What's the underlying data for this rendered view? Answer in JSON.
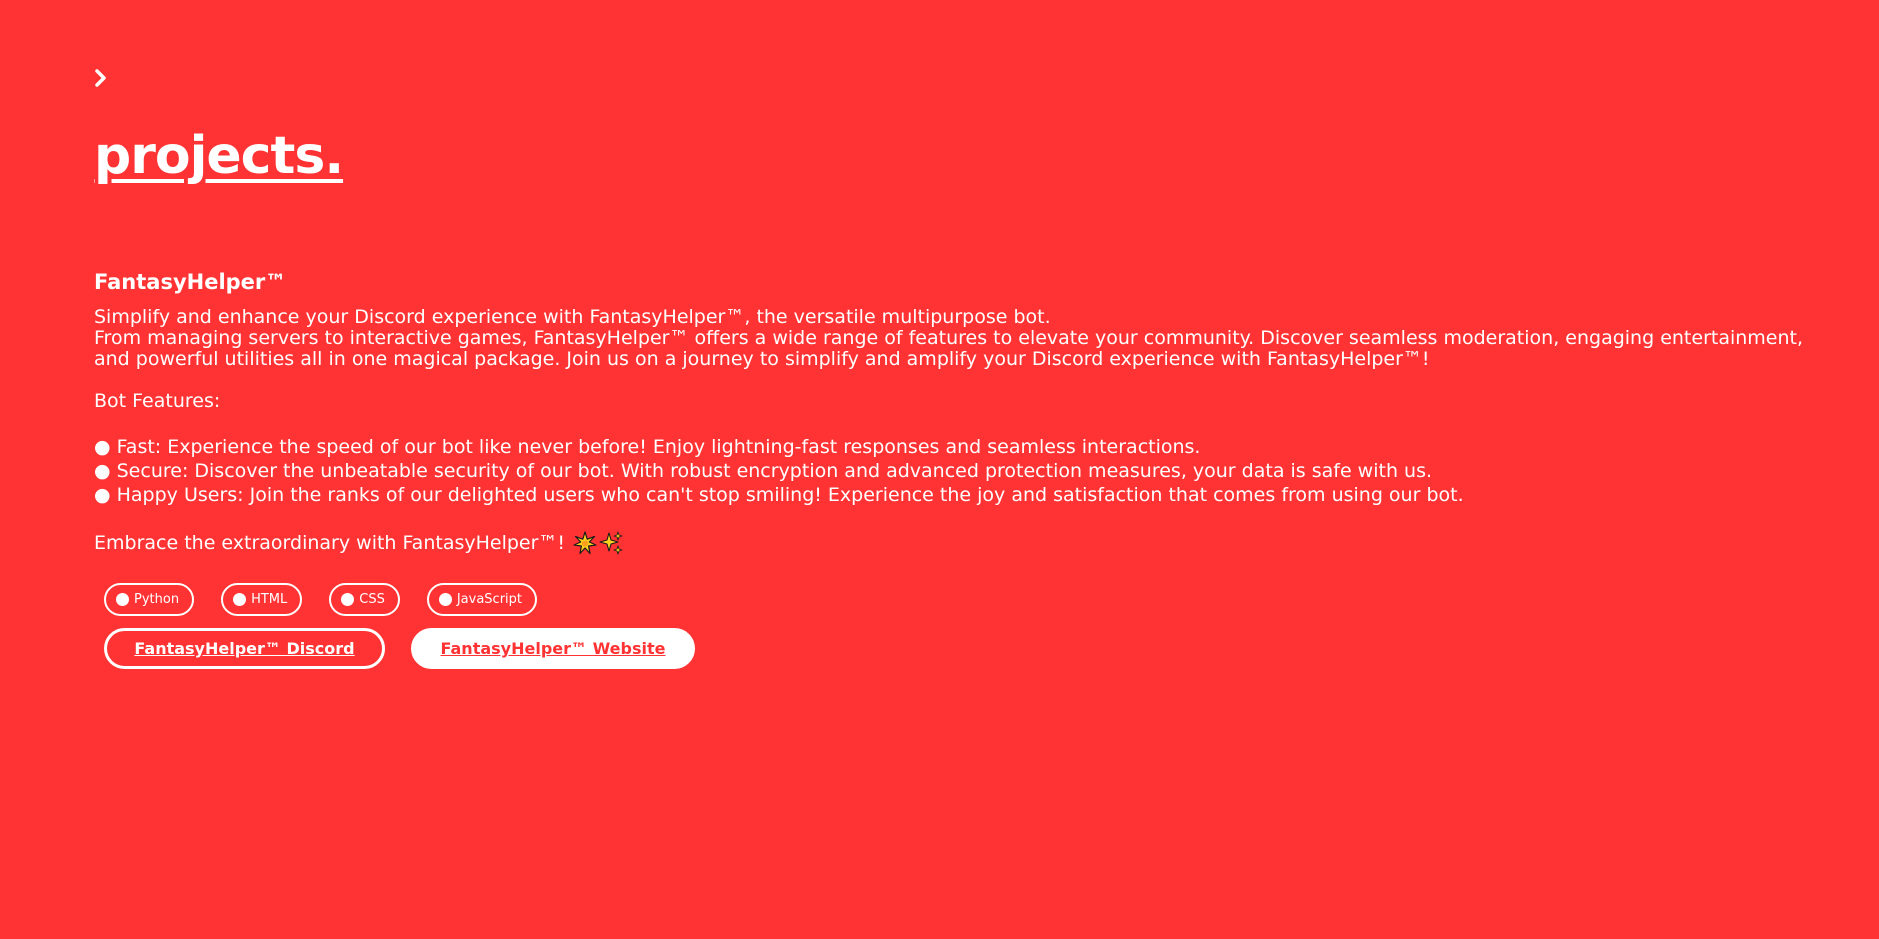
{
  "page": {
    "title": "projects.",
    "back_icon": "chevron-right-icon"
  },
  "project": {
    "name": "FantasyHelper™",
    "description": {
      "intro": "Simplify and enhance your Discord experience with FantasyHelper™, the versatile multipurpose bot.",
      "line1": "From managing servers to interactive games, FantasyHelper™ offers a wide range of features to elevate your community. Discover seamless moderation, engaging entertainment,",
      "line2": "and powerful utilities all in one magical package. Join us on a journey to simplify and amplify your Discord experience with FantasyHelper™!"
    },
    "features_heading": "Bot Features:",
    "features": [
      "● Fast: Experience the speed of our bot like never before! Enjoy lightning-fast responses and seamless interactions.",
      "● Secure: Discover the unbeatable security of our bot. With robust encryption and advanced protection measures, your data is safe with us.",
      "● Happy Users: Join the ranks of our delighted users who can't stop smiling! Experience the joy and satisfaction that comes from using our bot."
    ],
    "closing": "Embrace the extraordinary with FantasyHelper™!",
    "closing_icons": [
      "sparkle-burst-icon",
      "sparkles-icon"
    ],
    "tags": [
      "Python",
      "HTML",
      "CSS",
      "JavaScript"
    ],
    "buttons": {
      "discord": "FantasyHelper™ Discord",
      "website": "FantasyHelper™ Website"
    }
  },
  "colors": {
    "background": "#ff3333",
    "text": "#ffffff",
    "accent_button_text": "#ff3333"
  }
}
